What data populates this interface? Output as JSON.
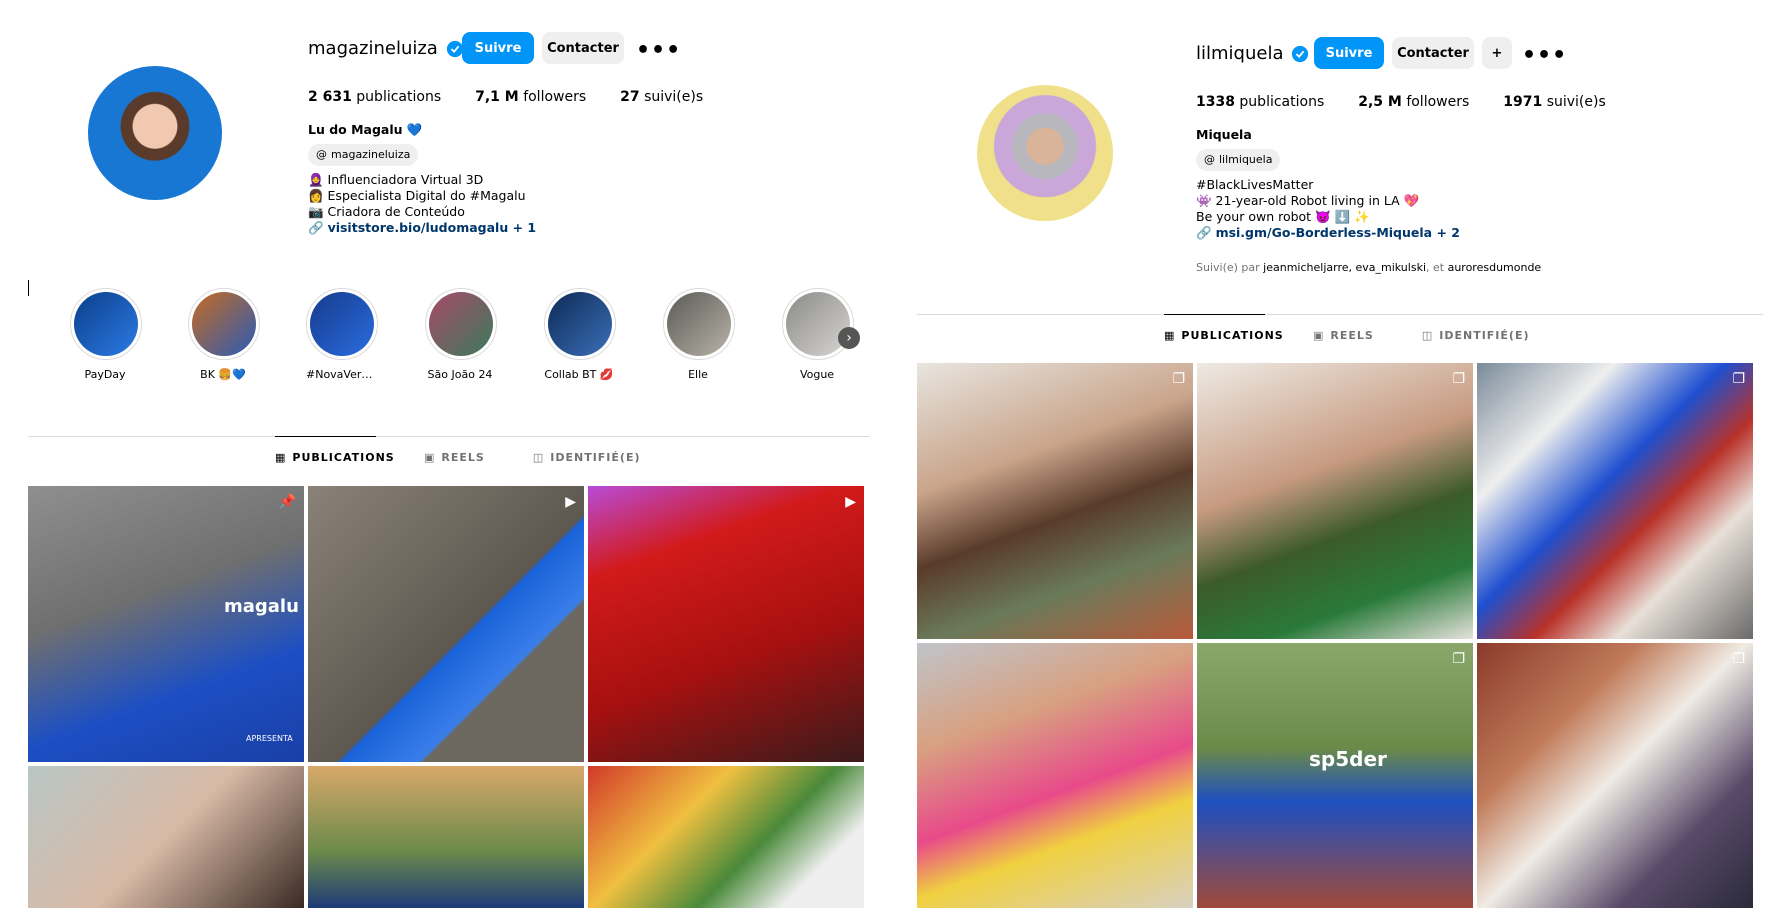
{
  "left": {
    "username": "magazineluiza",
    "follow_label": "Suivre",
    "contact_label": "Contacter",
    "more_label": "•••",
    "stats": [
      {
        "value": "2 631",
        "label": "publications"
      },
      {
        "value": "7,1 M",
        "label": "followers"
      },
      {
        "value": "27",
        "label": "suivi(e)s"
      }
    ],
    "bio": {
      "name": "Lu do Magalu 💙",
      "threads": "magazineluiza",
      "lines": [
        "🧕 Influenciadora Virtual 3D",
        "👩 Especialista Digital do #Magalu",
        "📷 Criadora de Conteúdo"
      ],
      "link": "visitstore.bio/ludomagalu",
      "link_extra": " + 1"
    },
    "highlights": [
      "PayDay",
      "BK 🍔💙",
      "#NovaVersao...",
      "São João 24",
      "Collab BT 💋",
      "Elle",
      "Vogue"
    ],
    "tabs": [
      "PUBLICATIONS",
      "REELS",
      "IDENTIFIÉ(E)"
    ],
    "post_watermark": "magalu",
    "post_caption": "APRESENTA"
  },
  "right": {
    "username": "lilmiquela",
    "follow_label": "Suivre",
    "contact_label": "Contacter",
    "more_label": "•••",
    "stats": [
      {
        "value": "1338",
        "label": "publications"
      },
      {
        "value": "2,5 M",
        "label": "followers"
      },
      {
        "value": "1971",
        "label": "suivi(e)s"
      }
    ],
    "bio": {
      "name": "Miquela",
      "threads": "lilmiquela",
      "lines": [
        "#BlackLivesMatter",
        "👾 21-year-old Robot living in LA 💖",
        "Be your own robot 👿 ⬇️ ✨"
      ],
      "link": "msi.gm/Go-Borderless-Miquela",
      "link_extra": " + 2"
    },
    "mutual": {
      "prefix": "Suivi(e) par ",
      "names": "jeanmicheljarre, eva_mikulski",
      "sep": ", et ",
      "last": "auroresdumonde"
    },
    "tabs": [
      "PUBLICATIONS",
      "REELS",
      "IDENTIFIÉ(E)"
    ],
    "hoodie_text": "sp5der"
  },
  "colors": {
    "accent": "#0095f6",
    "link": "#00376b",
    "muted": "#737373"
  }
}
